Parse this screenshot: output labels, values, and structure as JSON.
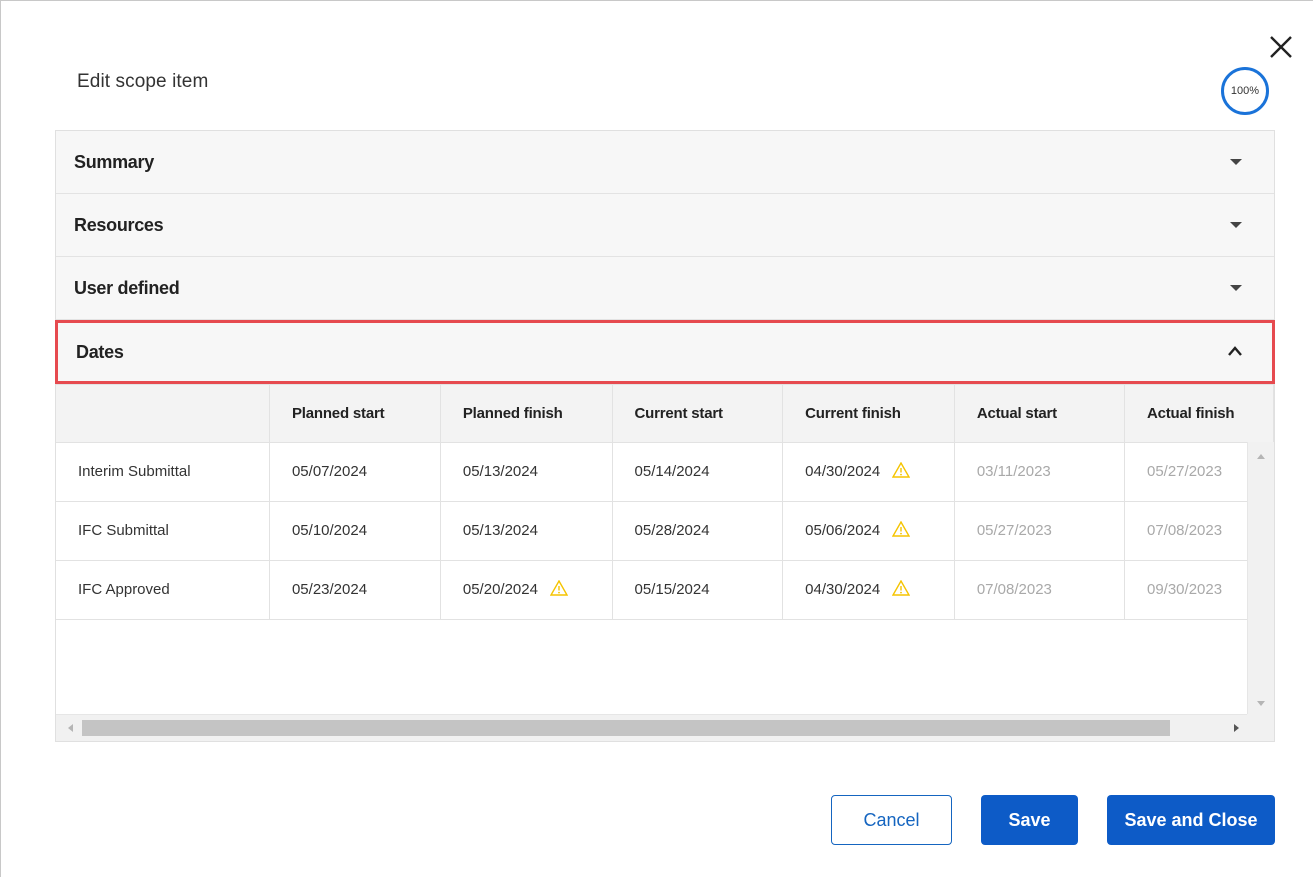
{
  "dialog": {
    "title": "Edit scope item",
    "progress_label": "100%",
    "accent_color": "#0d5bc7",
    "highlight_color": "#e64a4f",
    "warning_color": "#f5c400"
  },
  "sections": [
    {
      "label": "Summary",
      "expanded": false
    },
    {
      "label": "Resources",
      "expanded": false
    },
    {
      "label": "User defined",
      "expanded": false
    },
    {
      "label": "Dates",
      "expanded": true
    }
  ],
  "dates_table": {
    "columns": [
      "",
      "Planned start",
      "Planned finish",
      "Current start",
      "Current finish",
      "Actual start",
      "Actual finish"
    ],
    "rows": [
      {
        "label": "Interim Submittal",
        "planned_start": "05/07/2024",
        "planned_finish": "05/13/2024",
        "current_start": "05/14/2024",
        "current_finish": "04/30/2024",
        "actual_start": "03/11/2023",
        "actual_finish": "05/27/2023"
      },
      {
        "label": "IFC Submittal",
        "planned_start": "05/10/2024",
        "planned_finish": "05/13/2024",
        "current_start": "05/28/2024",
        "current_finish": "05/06/2024",
        "actual_start": "05/27/2023",
        "actual_finish": "07/08/2023"
      },
      {
        "label": "IFC Approved",
        "planned_start": "05/23/2024",
        "planned_finish": "05/20/2024",
        "current_start": "05/15/2024",
        "current_finish": "04/30/2024",
        "actual_start": "07/08/2023",
        "actual_finish": "09/30/2023"
      }
    ]
  },
  "buttons": {
    "cancel": "Cancel",
    "save": "Save",
    "save_and_close": "Save and Close"
  }
}
